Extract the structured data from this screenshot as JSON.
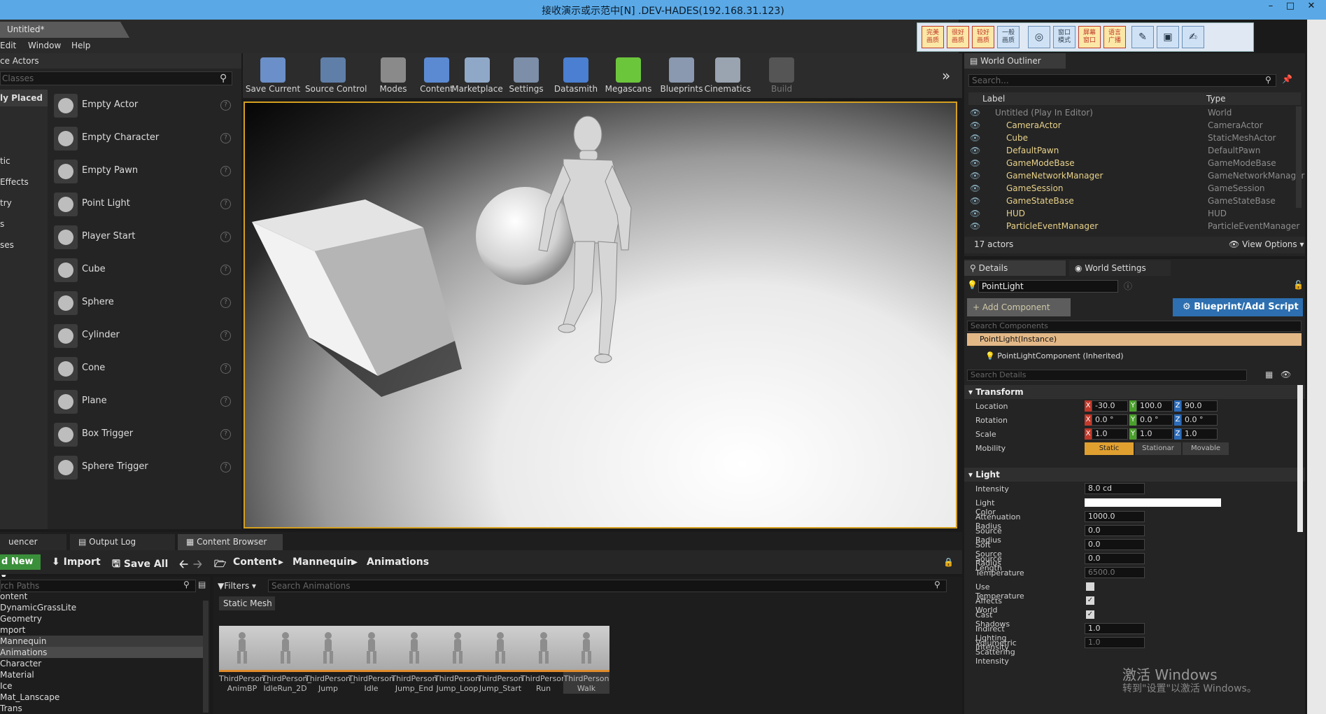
{
  "rdp": {
    "title": "接收演示或示范中[N] .DEV-HADES(192.168.31.123)"
  },
  "tabs": {
    "document": "Untitled*"
  },
  "menu": [
    "Edit",
    "Window",
    "Help"
  ],
  "toolbox": {
    "buttons": [
      "完美\n画质",
      "很好\n画质",
      "较好\n画质",
      "一般\n画质",
      "窗口\n模式",
      "屏幕\n窗口",
      "语言\n广播"
    ]
  },
  "place_actors": {
    "header": "ce Actors",
    "search_placeholder": "Classes",
    "categories": [
      "ly Placed",
      "tic",
      "Effects",
      "try",
      "s",
      "ses"
    ],
    "items": [
      "Empty Actor",
      "Empty Character",
      "Empty Pawn",
      "Point Light",
      "Player Start",
      "Cube",
      "Sphere",
      "Cylinder",
      "Cone",
      "Plane",
      "Box Trigger",
      "Sphere Trigger"
    ]
  },
  "toolbar": {
    "items": [
      {
        "label": "Save Current",
        "color": "#6b8fc9"
      },
      {
        "label": "Source Control",
        "color": "#5f7fa8"
      },
      {
        "label": "Modes",
        "color": "#8a8a8a"
      },
      {
        "label": "Content",
        "color": "#5b8ad3"
      },
      {
        "label": "Marketplace",
        "color": "#8fa8c8"
      },
      {
        "label": "Settings",
        "color": "#7c8ea8"
      },
      {
        "label": "Datasmith",
        "color": "#4a7fd1"
      },
      {
        "label": "Megascans",
        "color": "#6cc63c"
      },
      {
        "label": "Blueprints",
        "color": "#8a98b0"
      },
      {
        "label": "Cinematics",
        "color": "#9aa3b0"
      },
      {
        "label": "Build",
        "color": "#555555"
      }
    ]
  },
  "bottom_tabs": [
    "uencer",
    "Output Log",
    "Content Browser"
  ],
  "content_browser": {
    "add_new": "d New",
    "import": "Import",
    "save_all": "Save All",
    "breadcrumb": [
      "Content",
      "Mannequin",
      "Animations"
    ],
    "path_search": "rch Paths",
    "filters": "Filters",
    "asset_search": "Search Animations",
    "filter_chip": "Static Mesh",
    "paths": [
      "ontent",
      "DynamicGrassLite",
      "Geometry",
      "mport",
      "Mannequin",
      "Animations",
      "Character",
      "Material",
      "Ice",
      "Mat_Lanscape",
      "Trans"
    ],
    "assets": [
      [
        "ThirdPerson_",
        "AnimBP"
      ],
      [
        "ThirdPerson_",
        "IdleRun_2D"
      ],
      [
        "ThirdPerson_",
        "Jump"
      ],
      [
        "ThirdPerson",
        "Idle"
      ],
      [
        "ThirdPerson",
        "Jump_End"
      ],
      [
        "ThirdPerson",
        "Jump_Loop"
      ],
      [
        "ThirdPerson",
        "Jump_Start"
      ],
      [
        "ThirdPerson",
        "Run"
      ],
      [
        "ThirdPerson",
        "Walk"
      ]
    ]
  },
  "outliner": {
    "tab": "World Outliner",
    "search_placeholder": "Search...",
    "col_label": "Label",
    "col_type": "Type",
    "rows": [
      {
        "label": "Untitled (Play In Editor)",
        "type": "World"
      },
      {
        "label": "CameraActor",
        "type": "CameraActor"
      },
      {
        "label": "Cube",
        "type": "StaticMeshActor"
      },
      {
        "label": "DefaultPawn",
        "type": "DefaultPawn"
      },
      {
        "label": "GameModeBase",
        "type": "GameModeBase"
      },
      {
        "label": "GameNetworkManager",
        "type": "GameNetworkManager"
      },
      {
        "label": "GameSession",
        "type": "GameSession"
      },
      {
        "label": "GameStateBase",
        "type": "GameStateBase"
      },
      {
        "label": "HUD",
        "type": "HUD"
      },
      {
        "label": "ParticleEventManager",
        "type": "ParticleEventManager"
      }
    ],
    "count": "17 actors",
    "view_options": "View Options"
  },
  "details": {
    "tab": "Details",
    "tab2": "World Settings",
    "name": "PointLight",
    "add_component": "+ Add Component",
    "blueprint": "Blueprint/Add Script",
    "search_components": "Search Components",
    "instance": "PointLight(Instance)",
    "component": "PointLightComponent (Inherited)",
    "search_details": "Search Details",
    "transform_header": "Transform",
    "location_label": "Location",
    "rotation_label": "Rotation",
    "scale_label": "Scale",
    "mobility_label": "Mobility",
    "location": [
      "-30.0",
      "100.0",
      "90.0"
    ],
    "rotation": [
      "0.0 °",
      "0.0 °",
      "0.0 °"
    ],
    "scale": [
      "1.0",
      "1.0",
      "1.0"
    ],
    "mobility": [
      "Static",
      "Stationar",
      "Movable"
    ],
    "light_header": "Light",
    "light_props": [
      {
        "label": "Intensity",
        "value": "8.0 cd"
      },
      {
        "label": "Light Color",
        "value": ""
      },
      {
        "label": "Attenuation Radius",
        "value": "1000.0"
      },
      {
        "label": "Source Radius",
        "value": "0.0"
      },
      {
        "label": "Soft Source Radius",
        "value": "0.0"
      },
      {
        "label": "Source Length",
        "value": "0.0"
      },
      {
        "label": "Temperature",
        "value": "6500.0"
      },
      {
        "label": "Use Temperature",
        "value": ""
      },
      {
        "label": "Affects World",
        "value": ""
      },
      {
        "label": "Cast Shadows",
        "value": ""
      },
      {
        "label": "Indirect Lighting Intensity",
        "value": "1.0"
      },
      {
        "label": "Volumetric Scattering Intensity",
        "value": "1.0"
      }
    ]
  },
  "watermark": {
    "line1": "激活 Windows",
    "line2": "转到\"设置\"以激活 Windows。"
  }
}
